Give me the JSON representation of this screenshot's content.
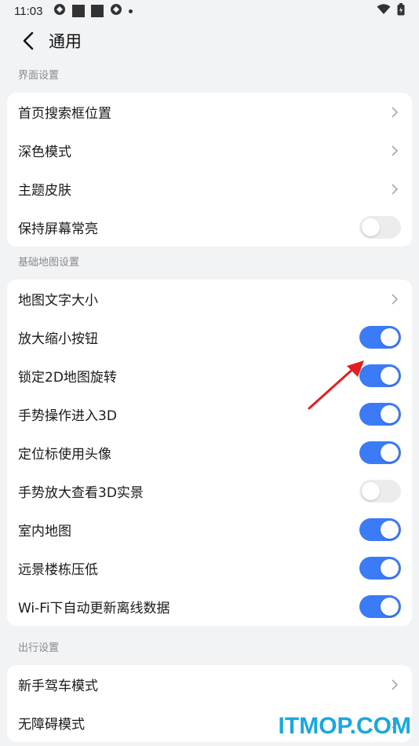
{
  "status_bar": {
    "time": "11:03"
  },
  "header": {
    "title": "通用"
  },
  "sections": [
    {
      "label": "界面设置",
      "items": [
        {
          "label": "首页搜索框位置",
          "type": "chevron"
        },
        {
          "label": "深色模式",
          "type": "chevron"
        },
        {
          "label": "主题皮肤",
          "type": "chevron"
        },
        {
          "label": "保持屏幕常亮",
          "type": "toggle",
          "on": false
        }
      ]
    },
    {
      "label": "基础地图设置",
      "items": [
        {
          "label": "地图文字大小",
          "type": "chevron"
        },
        {
          "label": "放大缩小按钮",
          "type": "toggle",
          "on": true
        },
        {
          "label": "锁定2D地图旋转",
          "type": "toggle",
          "on": true
        },
        {
          "label": "手势操作进入3D",
          "type": "toggle",
          "on": true
        },
        {
          "label": "定位标使用头像",
          "type": "toggle",
          "on": true
        },
        {
          "label": "手势放大查看3D实景",
          "type": "toggle",
          "on": false
        },
        {
          "label": "室内地图",
          "type": "toggle",
          "on": true
        },
        {
          "label": "远景楼栋压低",
          "type": "toggle",
          "on": true
        },
        {
          "label": "Wi-Fi下自动更新离线数据",
          "type": "toggle",
          "on": true
        }
      ]
    },
    {
      "label": "出行设置",
      "items": [
        {
          "label": "新手驾车模式",
          "type": "chevron"
        },
        {
          "label": "无障碍模式",
          "type": "chevron"
        }
      ]
    }
  ],
  "watermark": "ITMOP.COM",
  "colors": {
    "accent": "#3b7bf6",
    "toggle_off": "#ececec",
    "background": "#f2f3f5",
    "annotation": "#e02020"
  }
}
